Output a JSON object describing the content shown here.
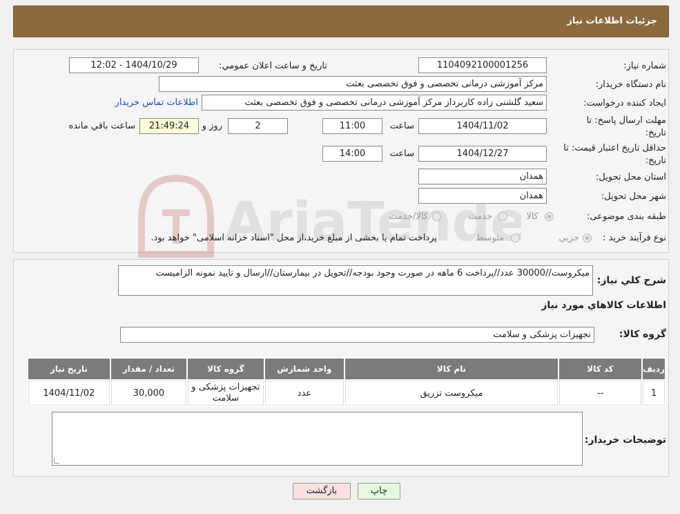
{
  "header": {
    "title": "جزئیات اطلاعات نیاز"
  },
  "form": {
    "need_number_label": "شماره نیاز:",
    "need_number": "1104092100001256",
    "announce_label": "تاریخ و ساعت اعلان عمومي:",
    "announce_value": "1404/10/29 - 12:02",
    "buyer_org_label": "نام دستگاه خریدار:",
    "buyer_org": "مرکز آموزشی درمانی تخصصی و فوق تخصصی بعثت",
    "creator_label": "ایجاد کننده درخواست:",
    "creator": "سعید گلشنی زاده کاربرداز مرکز آموزشی درمانی تخصصی و فوق تخصصی بعثت",
    "contact_link": "اطلاعات تماس خریدار",
    "reply_deadline_label": "مهلت ارسال پاسخ: تا تاریخ:",
    "reply_date": "1404/11/02",
    "time_label": "ساعت",
    "reply_time": "11:00",
    "days_value": "2",
    "days_label": "روز و",
    "remaining_time": "21:49:24",
    "remaining_label": "ساعت باقي مانده",
    "validity_label": "حداقل تاریخ اعتبار قیمت: تا تاریخ:",
    "validity_date": "1404/12/27",
    "validity_time": "14:00",
    "province_label": "استان محل تحویل:",
    "province": "همدان",
    "city_label": "شهر محل تحویل:",
    "city": "همدان",
    "category_label": "طبقه بندی موضوعی:",
    "category_options": [
      "کالا",
      "خدمت",
      "کالا/خدمت"
    ],
    "process_label": "نوع فرآیند خرید :",
    "process_options": [
      "جزیي",
      "متوسط"
    ],
    "process_note": "پرداخت تمام یا بخشی از مبلغ خرید،از محل \"اسناد خزانه اسلامی\" خواهد بود."
  },
  "details": {
    "summary_label": "شرح کلي نیاز:",
    "summary": "میکروست//30000 عدد//پرداخت 6 ماهه در صورت وجود بودجه//تحویل در بیمارستان//ارسال و تایید نمونه الزامیست",
    "items_title": "اطلاعات کالاهاي مورد نیاز",
    "group_label": "گروه کالا:",
    "group_value": "تجهیزات پزشکی و سلامت",
    "table": {
      "headers": [
        "ردیف",
        "کد کالا",
        "نام کالا",
        "واحد شمارش",
        "گروه کالا",
        "تعداد / مقدار",
        "تاریخ نیاز"
      ],
      "rows": [
        [
          "1",
          "--",
          "میکروست تزریق",
          "عدد",
          "تجهیزات پزشکی و سلامت",
          "30,000",
          "1404/11/02"
        ]
      ]
    },
    "buyer_notes_label": "توضیحات خریدار:"
  },
  "buttons": {
    "print": "چاپ",
    "back": "بازگشت"
  },
  "watermark": "AriaTender.neT",
  "colors": {
    "header": "#8b6a3e",
    "link": "#1a4fbf",
    "remaining_bg": "#fdfbd8",
    "print_bg": "#e6f9de",
    "back_bg": "#fbe1e1"
  }
}
